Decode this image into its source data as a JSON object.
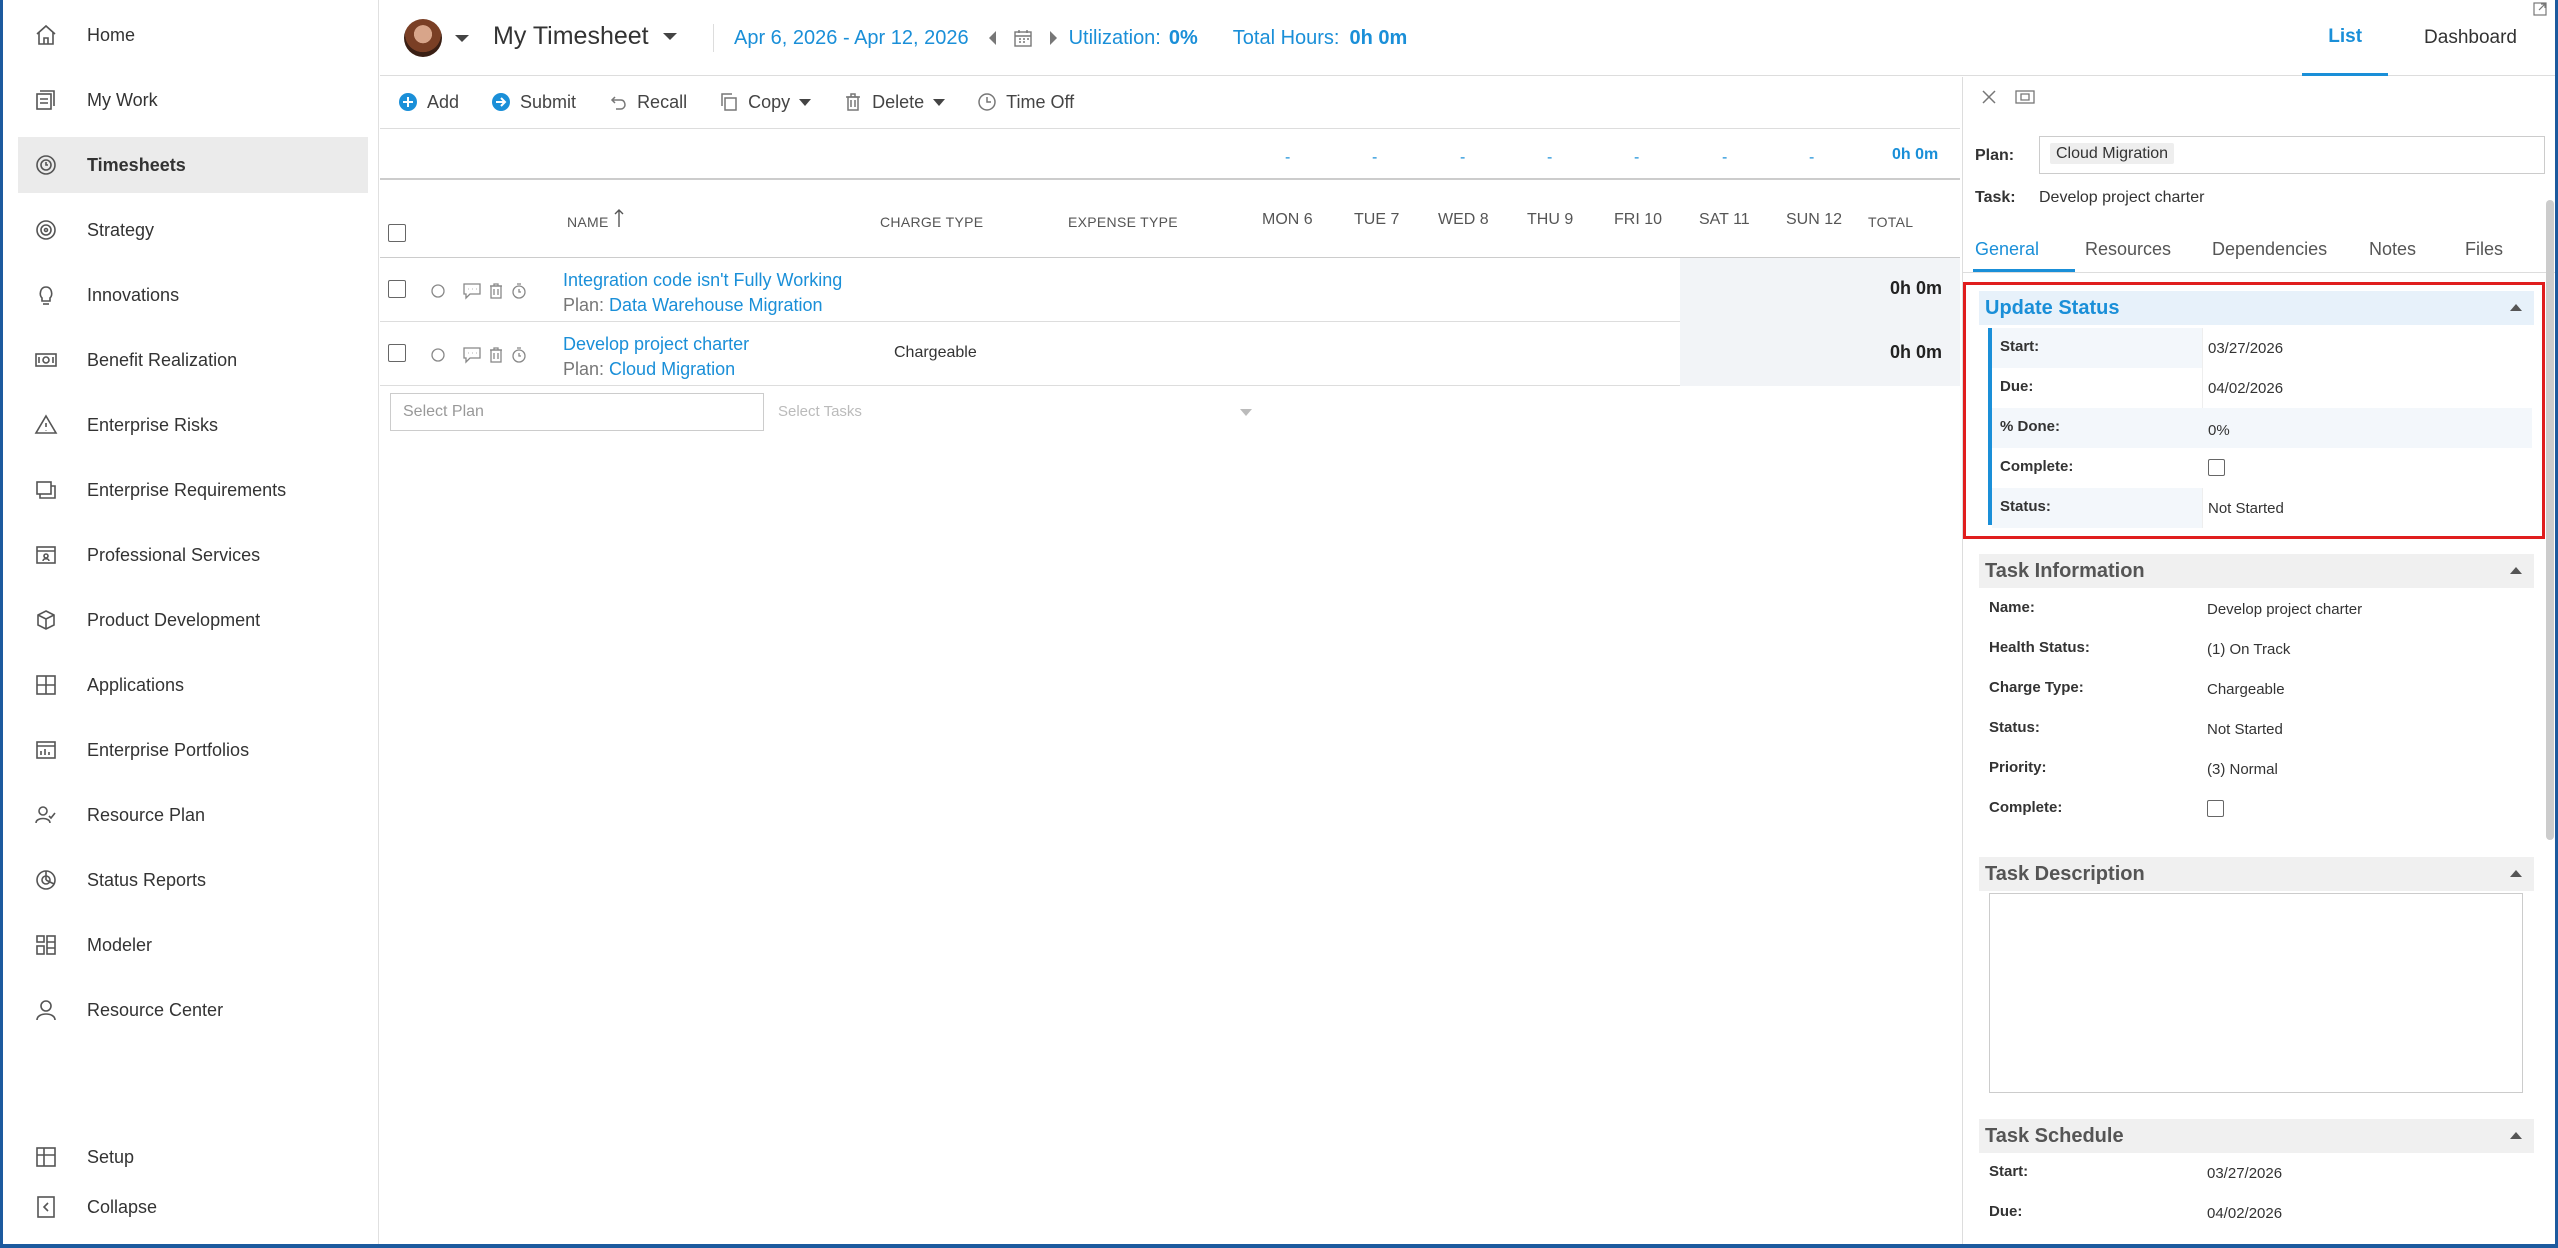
{
  "sidebar": {
    "items": [
      {
        "label": "Home",
        "icon": "home-icon"
      },
      {
        "label": "My Work",
        "icon": "my-work-icon"
      },
      {
        "label": "Timesheets",
        "icon": "timesheets-icon"
      },
      {
        "label": "Strategy",
        "icon": "strategy-icon"
      },
      {
        "label": "Innovations",
        "icon": "lightbulb-icon"
      },
      {
        "label": "Benefit Realization",
        "icon": "money-icon"
      },
      {
        "label": "Enterprise Risks",
        "icon": "warning-icon"
      },
      {
        "label": "Enterprise Requirements",
        "icon": "requirements-icon"
      },
      {
        "label": "Professional Services",
        "icon": "services-icon"
      },
      {
        "label": "Product Development",
        "icon": "product-icon"
      },
      {
        "label": "Applications",
        "icon": "applications-icon"
      },
      {
        "label": "Enterprise Portfolios",
        "icon": "portfolio-icon"
      },
      {
        "label": "Resource Plan",
        "icon": "resource-plan-icon"
      },
      {
        "label": "Status Reports",
        "icon": "status-reports-icon"
      },
      {
        "label": "Modeler",
        "icon": "modeler-icon"
      },
      {
        "label": "Resource Center",
        "icon": "person-icon"
      }
    ],
    "setup": "Setup",
    "collapse": "Collapse"
  },
  "header": {
    "title": "My Timesheet",
    "date_range": "Apr 6, 2026 - Apr 12, 2026",
    "utilization_label": "Utilization:",
    "utilization_value": "0%",
    "total_hours_label": "Total Hours:",
    "total_hours_value": "0h 0m",
    "view_tabs": [
      "List",
      "Dashboard"
    ],
    "active_view": "List"
  },
  "toolbar": {
    "add": "Add",
    "submit": "Submit",
    "recall": "Recall",
    "copy": "Copy",
    "delete": "Delete",
    "time_off": "Time Off"
  },
  "grid": {
    "day_totals": [
      "-",
      "-",
      "-",
      "-",
      "-",
      "-",
      "-"
    ],
    "grand_total": "0h 0m",
    "columns": {
      "name": "NAME",
      "charge_type": "CHARGE TYPE",
      "expense_type": "EXPENSE TYPE",
      "days": [
        "MON 6",
        "TUE 7",
        "WED 8",
        "THU 9",
        "FRI 10",
        "SAT 11",
        "SUN 12"
      ],
      "total": "TOTAL"
    },
    "rows": [
      {
        "name": "Integration code isn't Fully Working",
        "plan_prefix": "Plan:",
        "plan": "Data Warehouse Migration",
        "charge_type": "",
        "total": "0h 0m"
      },
      {
        "name": "Develop project charter",
        "plan_prefix": "Plan:",
        "plan": "Cloud Migration",
        "charge_type": "Chargeable",
        "total": "0h 0m"
      }
    ],
    "select_plan_placeholder": "Select Plan",
    "select_tasks_placeholder": "Select Tasks"
  },
  "panel": {
    "plan_label": "Plan:",
    "plan_value": "Cloud Migration",
    "task_label": "Task:",
    "task_value": "Develop project charter",
    "tabs": [
      "General",
      "Resources",
      "Dependencies",
      "Notes",
      "Files"
    ],
    "active_tab": "General",
    "update_status": {
      "title": "Update Status",
      "start_label": "Start:",
      "start_value": "03/27/2026",
      "due_label": "Due:",
      "due_value": "04/02/2026",
      "done_label": "% Done:",
      "done_value": "0%",
      "complete_label": "Complete:",
      "status_label": "Status:",
      "status_value": "Not Started"
    },
    "task_information": {
      "title": "Task Information",
      "name_label": "Name:",
      "name_value": "Develop project charter",
      "health_label": "Health Status:",
      "health_value": "(1) On Track",
      "charge_label": "Charge Type:",
      "charge_value": "Chargeable",
      "status_label": "Status:",
      "status_value": "Not Started",
      "priority_label": "Priority:",
      "priority_value": "(3) Normal",
      "complete_label": "Complete:"
    },
    "task_description": {
      "title": "Task Description"
    },
    "task_schedule": {
      "title": "Task Schedule",
      "start_label": "Start:",
      "start_value": "03/27/2026",
      "due_label": "Due:",
      "due_value": "04/02/2026"
    }
  },
  "colors": {
    "accent": "#1a8fd8",
    "highlight_border": "#e01e1e",
    "frame": "#1c5a9e"
  }
}
